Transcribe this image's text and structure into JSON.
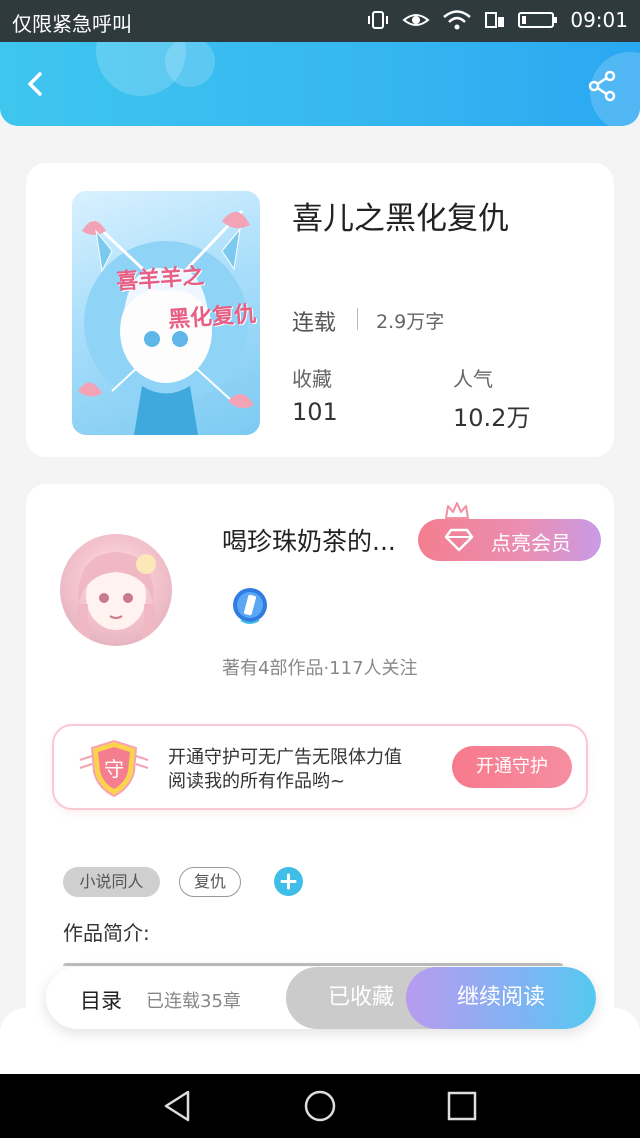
{
  "status_bar": {
    "carrier": "仅限紧急呼叫",
    "time": "09:01"
  },
  "book": {
    "title": "喜儿之黑化复仇",
    "cover_line1": "喜羊羊之",
    "cover_line2": "黑化复仇",
    "status": "连载",
    "word_count": "2.9万字",
    "favorites_label": "收藏",
    "favorites_value": "101",
    "popularity_label": "人气",
    "popularity_value": "10.2万"
  },
  "author": {
    "name": "喝珍珠奶茶的...",
    "vip_label": "点亮会员",
    "stats": "著有4部作品·117人关注"
  },
  "guard": {
    "shield_char": "守",
    "text": "开通守护可无广告无限体力值阅读我的所有作品哟~",
    "button": "开通守护"
  },
  "tags": [
    "小说同人",
    "复仇"
  ],
  "intro_label": "作品简介:",
  "bottom_bar": {
    "toc_label": "目录",
    "chapter_count": "已连载35章",
    "collected_label": "已收藏",
    "continue_label": "继续阅读"
  },
  "colors": {
    "header": "#35b6f0",
    "vip": "#f47e8f",
    "guard_button": "#f77a8b",
    "continue": "#7fb3f2"
  },
  "icons": [
    "back-arrow-icon",
    "share-icon",
    "crown-icon",
    "diamond-icon",
    "author-badge-icon",
    "shield-icon",
    "plus-icon",
    "nav-back-icon",
    "nav-home-icon",
    "nav-recent-icon"
  ]
}
